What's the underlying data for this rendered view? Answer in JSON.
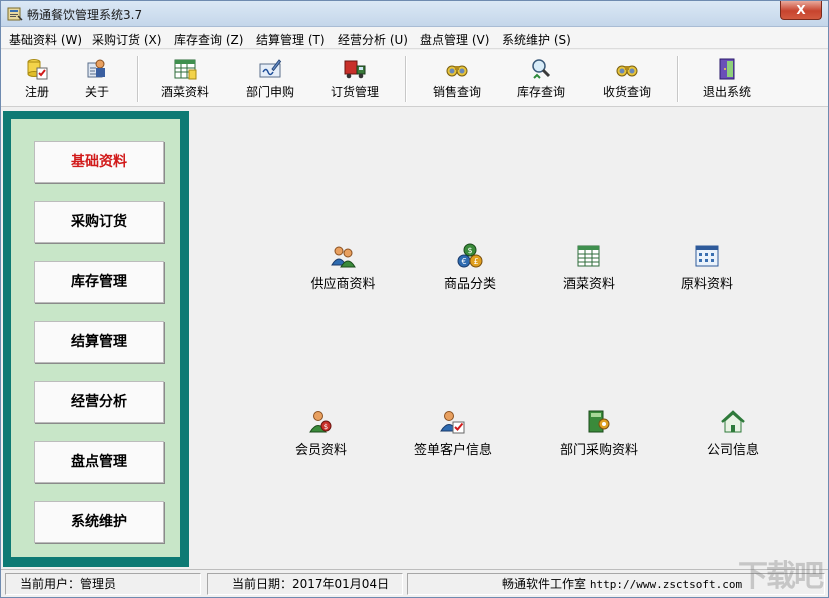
{
  "window": {
    "title": "畅通餐饮管理系统3.7",
    "close_glyph": "X"
  },
  "menu": [
    "基础资料 (W)",
    "采购订货 (X)",
    "库存查询 (Z)",
    "结算管理 (T)",
    "经营分析 (U)",
    "盘点管理 (V)",
    "系统维护 (S)"
  ],
  "toolbar": [
    {
      "label": "注册",
      "icon": "register-icon"
    },
    {
      "label": "关于",
      "icon": "about-icon"
    },
    {
      "label": "酒菜资料",
      "icon": "spreadsheet-icon"
    },
    {
      "label": "部门申购",
      "icon": "signature-icon"
    },
    {
      "label": "订货管理",
      "icon": "truck-icon"
    },
    {
      "label": "销售查询",
      "icon": "binoculars-icon"
    },
    {
      "label": "库存查询",
      "icon": "magnifier-icon"
    },
    {
      "label": "收货查询",
      "icon": "binoculars-icon"
    },
    {
      "label": "退出系统",
      "icon": "exit-door-icon"
    }
  ],
  "sidebar": [
    {
      "label": "基础资料",
      "active": true
    },
    {
      "label": "采购订货",
      "active": false
    },
    {
      "label": "库存管理",
      "active": false
    },
    {
      "label": "结算管理",
      "active": false
    },
    {
      "label": "经营分析",
      "active": false
    },
    {
      "label": "盘点管理",
      "active": false
    },
    {
      "label": "系统维护",
      "active": false
    }
  ],
  "tiles": [
    {
      "label": "供应商资料",
      "icon": "users-icon"
    },
    {
      "label": "商品分类",
      "icon": "currency-coins-icon"
    },
    {
      "label": "酒菜资料",
      "icon": "spreadsheet-icon"
    },
    {
      "label": "原料资料",
      "icon": "calendar-grid-icon"
    },
    {
      "label": "会员资料",
      "icon": "member-icon"
    },
    {
      "label": "签单客户信息",
      "icon": "user-check-icon"
    },
    {
      "label": "部门采购资料",
      "icon": "book-gear-icon"
    },
    {
      "label": "公司信息",
      "icon": "home-icon"
    }
  ],
  "status": {
    "user": "当前用户：管理员",
    "date": "当前日期：2017年01月04日",
    "company": "畅通软件工作室",
    "url": "http://www.zsctsoft.com"
  },
  "watermark": "下载吧",
  "colors": {
    "sidebar_frame": "#0e7a74",
    "sidebar_inner": "#c8e6c8",
    "active_text": "#d11a1a",
    "close_button": "#c7442e"
  }
}
